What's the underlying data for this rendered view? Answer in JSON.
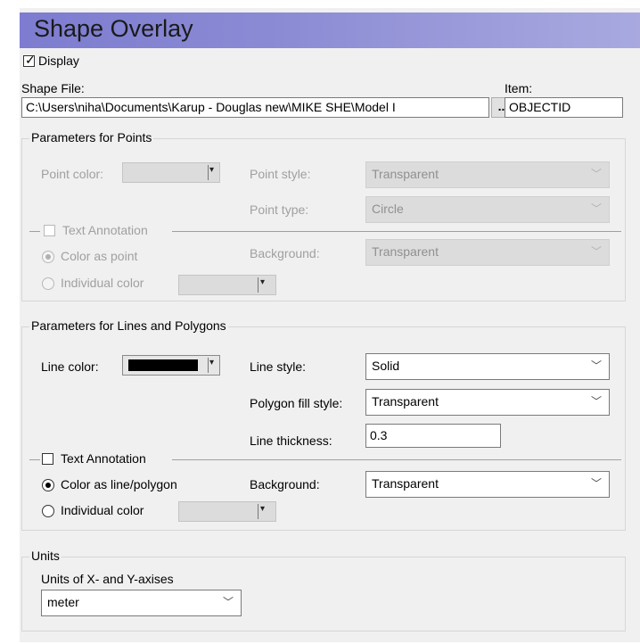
{
  "title": "Shape Overlay",
  "display": {
    "label": "Display",
    "checked": true
  },
  "shape_file": {
    "label": "Shape File:",
    "value": "C:\\Users\\niha\\Documents\\Karup - Douglas new\\MIKE SHE\\Model I",
    "browse_label": "..."
  },
  "item": {
    "label": "Item:",
    "value": "OBJECTID"
  },
  "points": {
    "group_title": "Parameters for Points",
    "point_color_label": "Point color:",
    "point_style_label": "Point style:",
    "point_style_value": "Transparent",
    "point_type_label": "Point type:",
    "point_type_value": "Circle",
    "text_annotation_label": "Text Annotation",
    "background_label": "Background:",
    "background_value": "Transparent",
    "color_as_point_label": "Color as point",
    "individual_color_label": "Individual color"
  },
  "lines": {
    "group_title": "Parameters for Lines and Polygons",
    "line_color_label": "Line color:",
    "line_color": "#000000",
    "line_style_label": "Line style:",
    "line_style_value": "Solid",
    "polygon_fill_label": "Polygon fill style:",
    "polygon_fill_value": "Transparent",
    "line_thickness_label": "Line thickness:",
    "line_thickness_value": "0.3",
    "text_annotation_label": "Text Annotation",
    "color_as_line_label": "Color as line/polygon",
    "individual_color_label": "Individual color",
    "background_label": "Background:",
    "background_value": "Transparent"
  },
  "units": {
    "group_title": "Units",
    "axes_label": "Units of X- and Y-axises",
    "axes_value": "meter"
  },
  "icons": {
    "check": "✓",
    "chevron": "﹀",
    "triangle": "▾"
  }
}
